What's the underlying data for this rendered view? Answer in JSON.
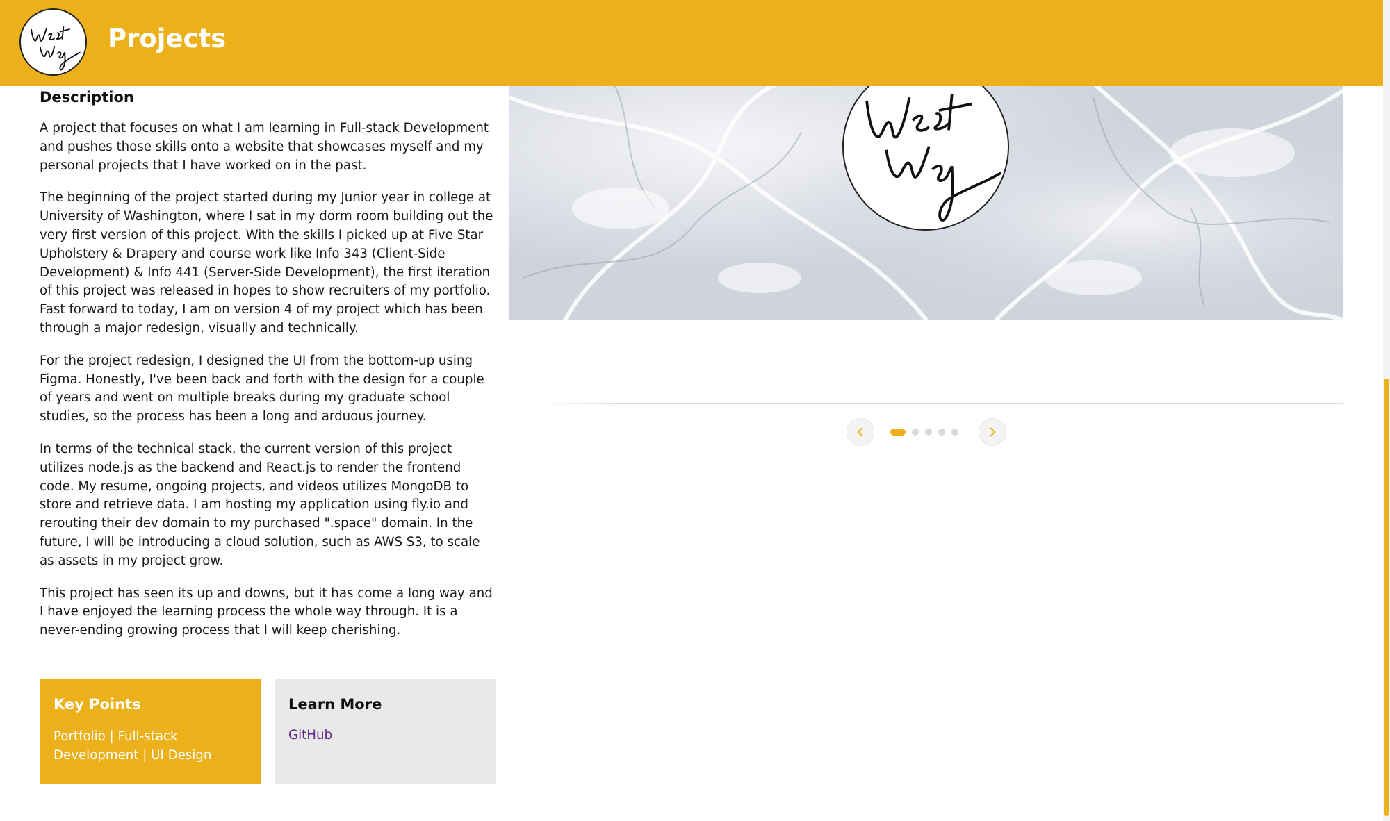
{
  "header": {
    "title": "Projects",
    "logo_icon": "west-way-logo"
  },
  "colors": {
    "accent": "#ecb01a",
    "box_grey": "#e9e9e9",
    "link": "#5b2a86",
    "white": "#ffffff"
  },
  "description": {
    "heading": "Description",
    "paragraphs": [
      "A project that focuses on what I am learning in Full-stack Development and pushes those skills onto a website that showcases myself and my personal projects that I have worked on in the past.",
      "The beginning of the project started during my Junior year in college at University of Washington, where I sat in my dorm room building out the very first version of this project. With the skills I picked up at Five Star Upholstery & Drapery and course work like Info 343 (Client-Side Development) & Info 441 (Server-Side Development), the first iteration of this project was released in hopes to show recruiters of my portfolio. Fast forward to today, I am on version 4 of my project which has been through a major redesign, visually and technically.",
      "For the project redesign, I designed the UI from the bottom-up using Figma. Honestly, I've been back and forth with the design for a couple of years and went on multiple breaks during my graduate school studies, so the process has been a long and arduous journey.",
      "In terms of the technical stack, the current version of this project utilizes node.js as the backend and React.js to render the frontend code. My resume, ongoing projects, and videos utilizes MongoDB to store and retrieve data. I am hosting my application using fly.io and rerouting their dev domain to my purchased \".space\" domain. In the future, I will be introducing a cloud solution, such as AWS S3, to scale as assets in my project grow.",
      "This project has seen its up and downs, but it has come a long way and I have enjoyed the learning process the whole way through. It is a never-ending growing process that I will keep cherishing."
    ]
  },
  "key_points": {
    "title": "Key Points",
    "text": "Portfolio | Full-stack Development | UI Design"
  },
  "learn_more": {
    "title": "Learn More",
    "link_label": "GitHub"
  },
  "carousel": {
    "slide_count": 5,
    "active_index": 0,
    "prev_icon": "chevron-left-icon",
    "next_icon": "chevron-right-icon"
  }
}
